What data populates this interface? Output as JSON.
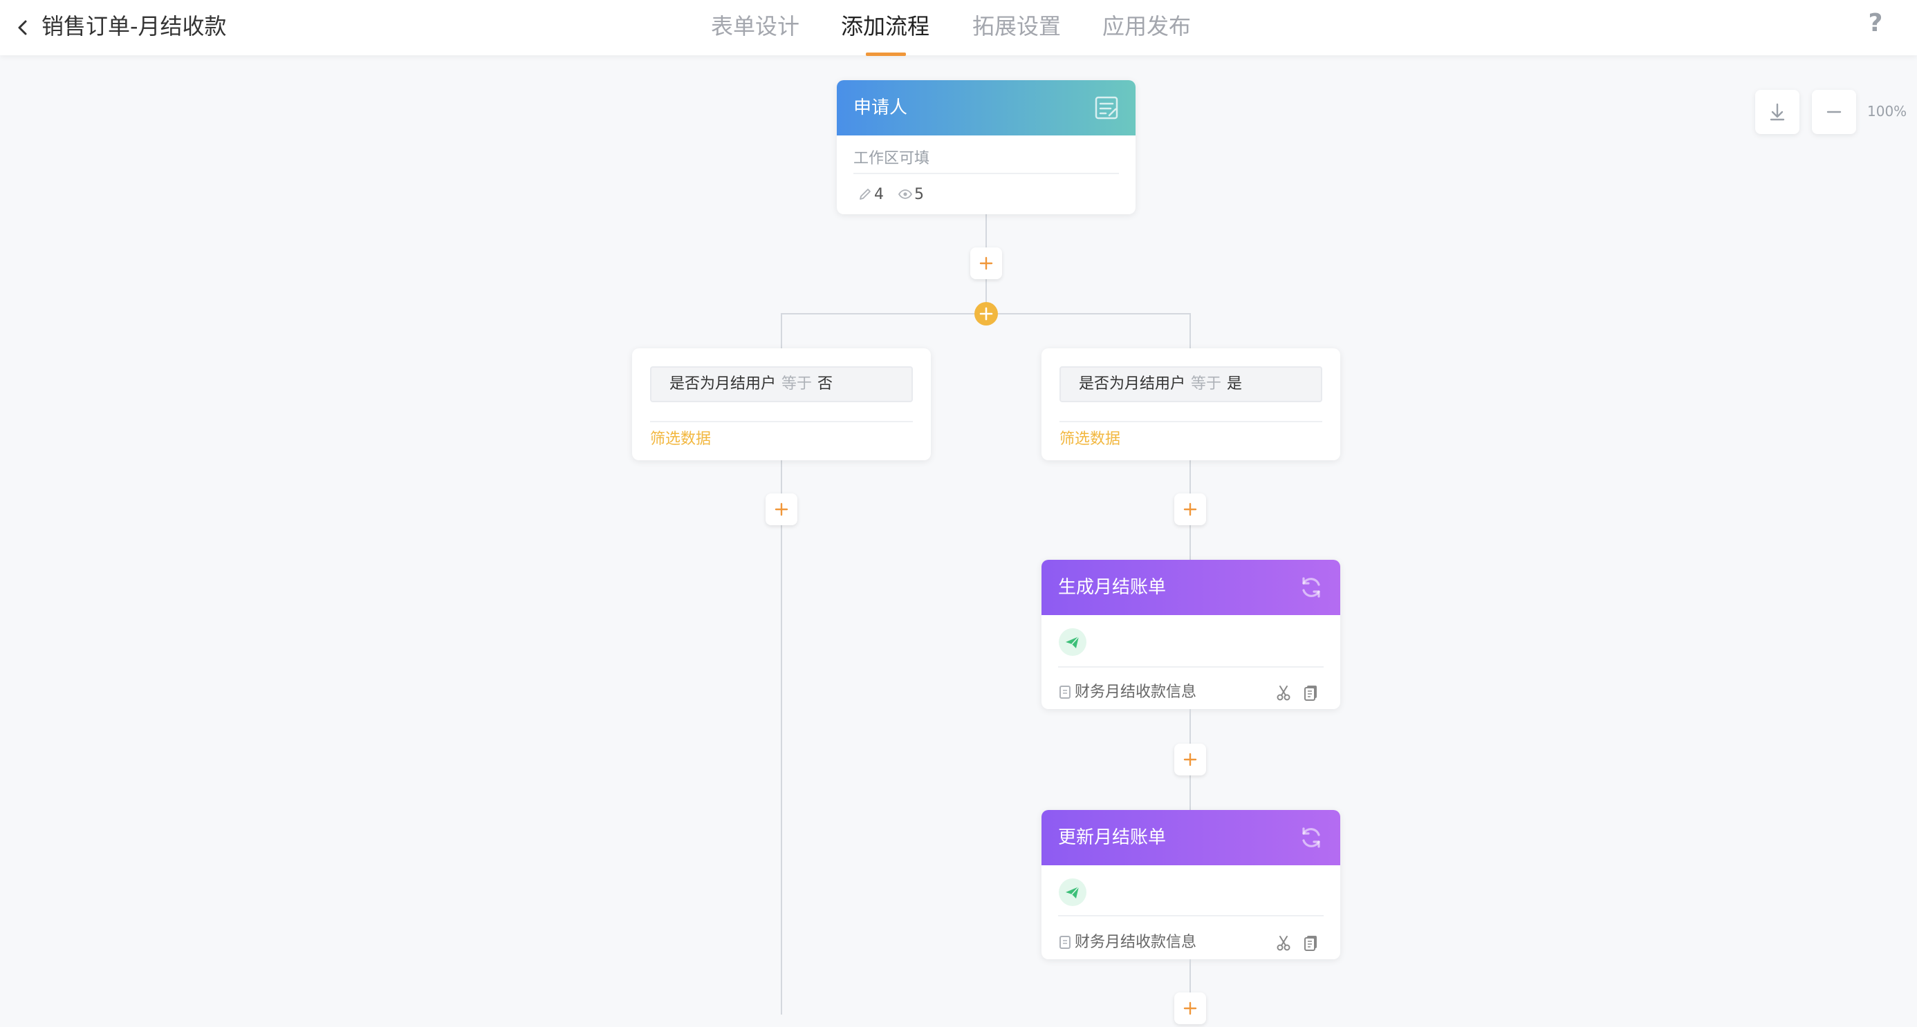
{
  "header": {
    "title": "销售订单-月结收款",
    "tabs": [
      {
        "label": "表单设计",
        "active": false
      },
      {
        "label": "添加流程",
        "active": true
      },
      {
        "label": "拓展设置",
        "active": false
      },
      {
        "label": "应用发布",
        "active": false
      }
    ],
    "help_label": "?",
    "accent_color": "#f0973a"
  },
  "canvas": {
    "zoom_label": "100%"
  },
  "flow": {
    "applicant_node": {
      "title": "申请人",
      "subtitle": "工作区可填",
      "edit_count": "4",
      "view_count": "5",
      "header_gradient": [
        "#4a90e8",
        "#6cc7c0"
      ]
    },
    "branches": [
      {
        "field": "是否为月结用户",
        "operator": "等于",
        "value": "否",
        "filter_label": "筛选数据"
      },
      {
        "field": "是否为月结用户",
        "operator": "等于",
        "value": "是",
        "filter_label": "筛选数据"
      }
    ],
    "action_nodes": [
      {
        "title": "生成月结账单",
        "target_form": "财务月结收款信息",
        "header_gradient": [
          "#8e5cf2",
          "#b46cf2"
        ]
      },
      {
        "title": "更新月结账单",
        "target_form": "财务月结收款信息",
        "header_gradient": [
          "#8e5cf2",
          "#b46cf2"
        ]
      }
    ],
    "branch_add_color": "#f2b73f",
    "add_button_color": "#f0973a"
  }
}
